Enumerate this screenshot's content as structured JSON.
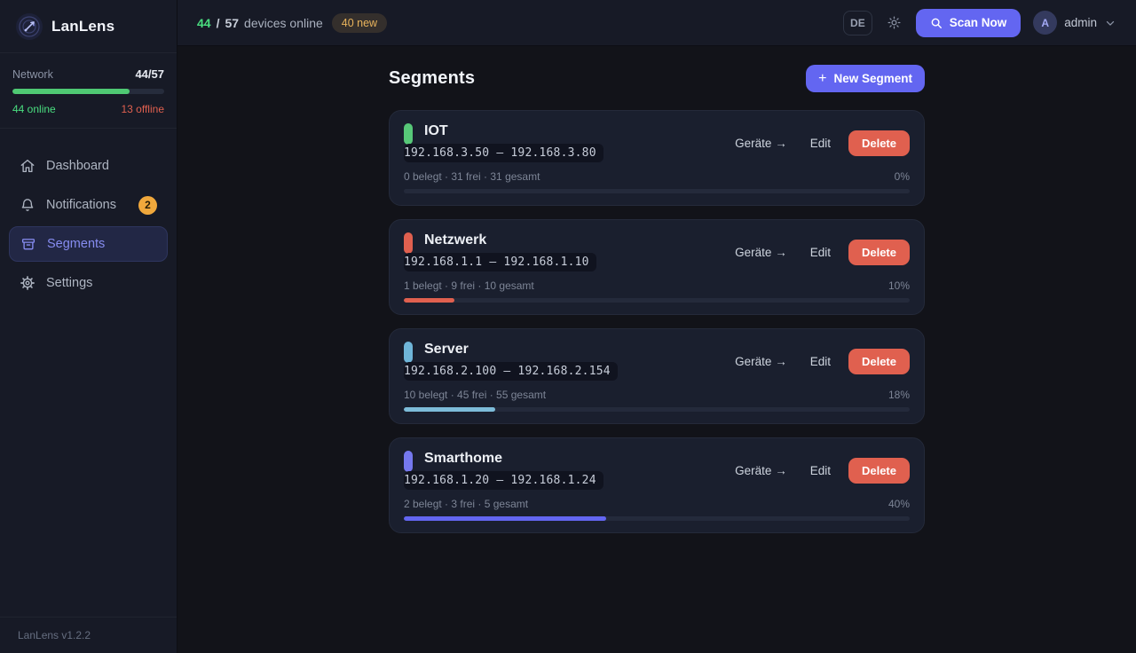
{
  "app": {
    "name": "LanLens",
    "footer_version": "LanLens v1.2.2"
  },
  "topbar": {
    "online": "44",
    "separator": "/",
    "total": "57",
    "devices_label": "devices online",
    "new_badge": "40 new",
    "lang": "DE",
    "scan_label": "Scan Now",
    "user_initial": "A",
    "user_name": "admin"
  },
  "sidebar": {
    "network": {
      "label": "Network",
      "ratio": "44/57",
      "online": "44 online",
      "offline": "13 offline",
      "percent": 77,
      "bar_color": "#4fc973"
    },
    "items": [
      {
        "label": "Dashboard"
      },
      {
        "label": "Notifications",
        "badge": "2"
      },
      {
        "label": "Segments"
      },
      {
        "label": "Settings"
      }
    ]
  },
  "main": {
    "title": "Segments",
    "new_segment_plus": "+",
    "new_segment_label": "New Segment",
    "actions": {
      "devices": "Geräte →",
      "edit": "Edit",
      "delete": "Delete"
    },
    "cards": [
      {
        "name": "IOT",
        "color": "#57c878",
        "range": "192.168.3.50 — 192.168.3.80",
        "stats": "0 belegt · 31 frei · 31 gesamt",
        "percent_label": "0%",
        "percent": 0,
        "bar_color": "#57c878"
      },
      {
        "name": "Netzwerk",
        "color": "#e0604f",
        "range": "192.168.1.1 — 192.168.1.10",
        "stats": "1 belegt · 9 frei · 10 gesamt",
        "percent_label": "10%",
        "percent": 10,
        "bar_color": "#e0604f"
      },
      {
        "name": "Server",
        "color": "#6fb5d8",
        "range": "192.168.2.100 — 192.168.2.154",
        "stats": "10 belegt · 45 frei · 55 gesamt",
        "percent_label": "18%",
        "percent": 18,
        "bar_color": "#7dbcd9"
      },
      {
        "name": "Smarthome",
        "color": "#7578ee",
        "range": "192.168.1.20 — 192.168.1.24",
        "stats": "2 belegt · 3 frei · 5 gesamt",
        "percent_label": "40%",
        "percent": 40,
        "bar_color": "#6366f1"
      }
    ]
  },
  "colors": {
    "accent": "#6366f1",
    "danger": "#e0604f",
    "online_green": "#4ade80",
    "offline_red": "#e0604f",
    "amber": "#e8b35c"
  }
}
